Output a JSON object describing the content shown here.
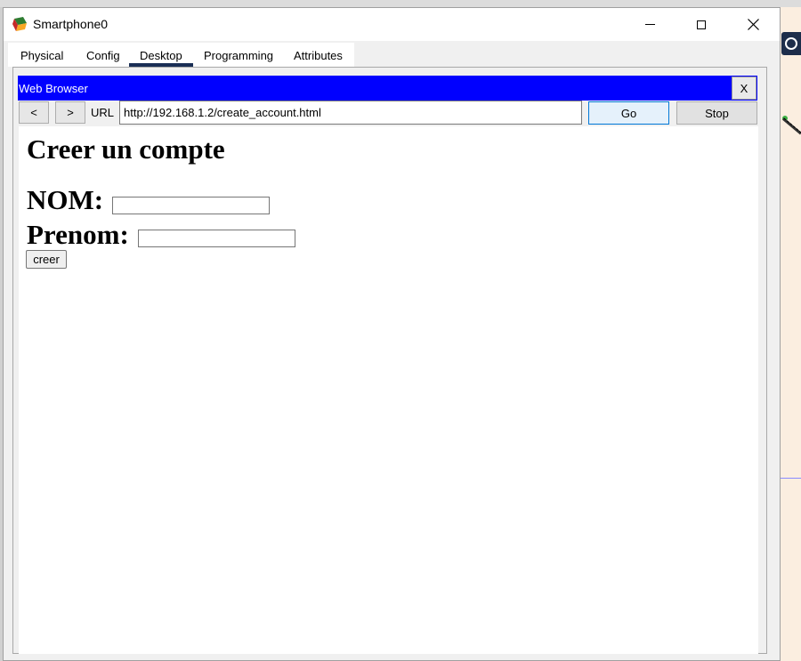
{
  "window": {
    "title": "Smartphone0",
    "app_icon": "packet-tracer-device-icon"
  },
  "tabs": [
    {
      "label": "Physical",
      "active": false
    },
    {
      "label": "Config",
      "active": false
    },
    {
      "label": "Desktop",
      "active": true
    },
    {
      "label": "Programming",
      "active": false
    },
    {
      "label": "Attributes",
      "active": false
    }
  ],
  "browser": {
    "title": "Web Browser",
    "close_label": "X",
    "back_label": "<",
    "forward_label": ">",
    "url_label": "URL",
    "url": "http://192.168.1.2/create_account.html",
    "go_label": "Go",
    "stop_label": "Stop",
    "header_color": "#0000ff"
  },
  "page": {
    "heading": "Creer un compte",
    "nom_label": "NOM:",
    "nom_value": "",
    "prenom_label": "Prenom:",
    "prenom_value": "",
    "submit_label": "creer"
  }
}
